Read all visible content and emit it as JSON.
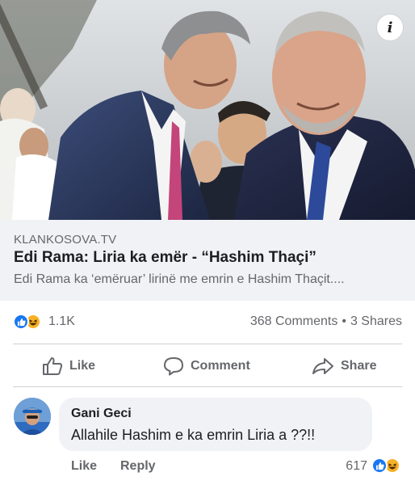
{
  "post": {
    "image": {
      "description_icon": "photo-illustration"
    },
    "info_label": "i",
    "link": {
      "domain": "KLANKOSOVA.TV",
      "headline": "Edi Rama: Liria ka emër - “Hashim Thaçi”",
      "description": "Edi Rama ka ‘emëruar’ lirinë me emrin e Hashim Thaçit...."
    },
    "stats": {
      "reactions_count": "1.1K",
      "comments": "368 Comments",
      "separator": "•",
      "shares": "3 Shares",
      "reaction_icons": [
        "like-icon",
        "haha-icon"
      ]
    },
    "actions": {
      "like": "Like",
      "comment": "Comment",
      "share": "Share"
    }
  },
  "comment": {
    "author": "Gani Geci",
    "text": "Allahile Hashim e ka emrin Liria a ??!!",
    "like_label": "Like",
    "reply_label": "Reply",
    "reactions_count": "617"
  },
  "colors": {
    "facebook_blue": "#1877f2",
    "haha_yellow": "#f7b125",
    "secondary_text": "#65676b",
    "link_box_bg": "#f0f2f5"
  }
}
